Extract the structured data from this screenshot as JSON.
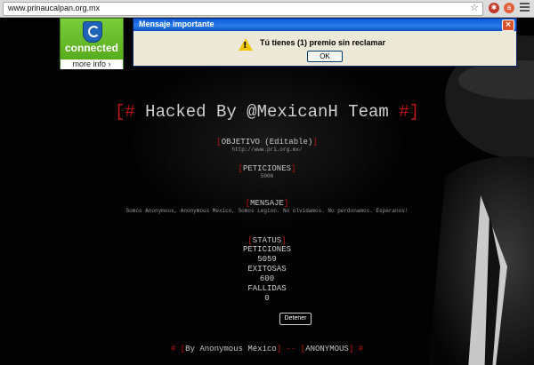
{
  "browser": {
    "url": "www.prinaucalpan.org.mx",
    "star_icon": "star-icon",
    "extensions": [
      "lastpass-icon",
      "avast-icon"
    ],
    "menu_icon": "hamburger-menu-icon"
  },
  "badge": {
    "text": "connected",
    "more": "more info",
    "icon": "shield-icon",
    "color": "#5fb322"
  },
  "dialog": {
    "title": "Mensaje importante",
    "message": "Tú tienes (1) premio sin reclamar",
    "ok_label": "OK",
    "close_label": "×",
    "icon": "warning-icon"
  },
  "page": {
    "title_open": "[#",
    "title_text": " Hacked By @MexicanH Team ",
    "title_close": "#]",
    "objetivo_label": "OBJETIVO (Editable)",
    "objetivo_value": "http://www.pri.org.mx/",
    "peticiones_label": "PETICIONES",
    "peticiones_value": "5006",
    "mensaje_label": "MENSAJE",
    "mensaje_value": "Somos Anonymous, Anonymous Mexico, Somos Legion. No olvidamos. No perdonamos. Esperanos!",
    "status_label": "STATUS",
    "status_lines": [
      "PETICIONES",
      "5059",
      "EXITOSAS",
      "600",
      "FALLIDAS",
      "0"
    ],
    "detener_label": "Detener",
    "footer_by": "By Anonymous México",
    "footer_anon": "ANONYMOUS",
    "accent_color": "#c0140e"
  }
}
